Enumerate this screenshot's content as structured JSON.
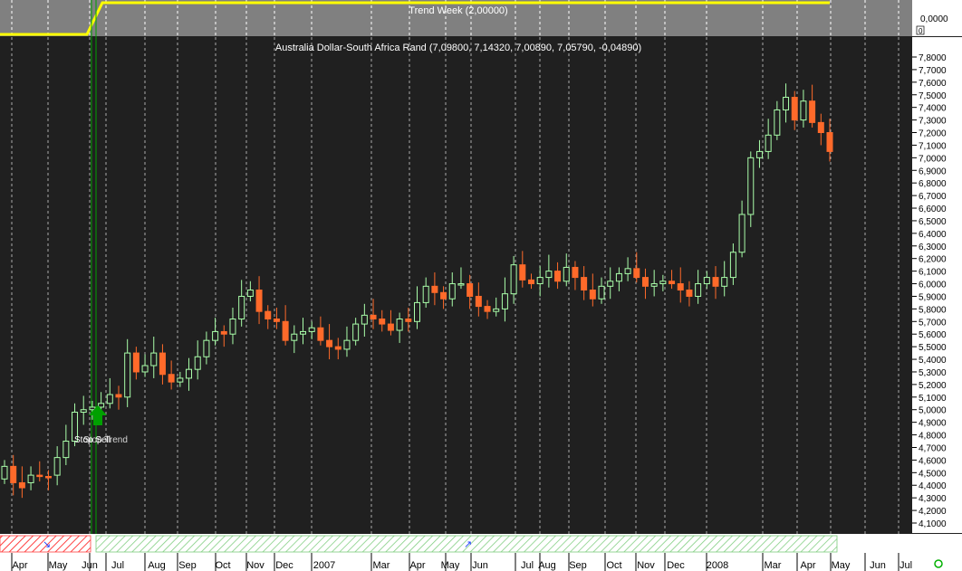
{
  "chart_data": {
    "type": "candlestick",
    "title": "Australia Dollar-South Africa Rand (7,09800, 7,14320, 7,00890, 7,05790, -0,04890)",
    "ylim": [
      4.0,
      7.9
    ],
    "y_ticks": [
      "7,8000",
      "7,7000",
      "7,6000",
      "7,5000",
      "7,4000",
      "7,3000",
      "7,2000",
      "7,1000",
      "7,0000",
      "6,9000",
      "6,8000",
      "6,7000",
      "6,6000",
      "6,5000",
      "6,4000",
      "6,3000",
      "6,2000",
      "6,1000",
      "6,0000",
      "5,9000",
      "5,8000",
      "5,7000",
      "5,6000",
      "5,5000",
      "5,4000",
      "5,3000",
      "5,2000",
      "5,1000",
      "5,0000",
      "4,9000",
      "4,8000",
      "4,7000",
      "4,6000",
      "4,5000",
      "4,4000",
      "4,3000",
      "4,2000",
      "4,1000"
    ],
    "x_ticks": [
      "Apr",
      "May",
      "Jun",
      "Jul",
      "Aug",
      "Sep",
      "Oct",
      "Nov",
      "Dec",
      "2007",
      "Mar",
      "Apr",
      "May",
      "Jun",
      "Jul",
      "Aug",
      "Sep",
      "Oct",
      "Nov",
      "Dec",
      "2008",
      "Mar",
      "Apr",
      "May",
      "Jun",
      "Jul"
    ],
    "closes": [
      4.55,
      4.42,
      4.38,
      4.48,
      4.47,
      4.46,
      4.62,
      4.75,
      4.98,
      5.0,
      5.02,
      5.05,
      5.12,
      5.1,
      5.45,
      5.3,
      5.35,
      5.45,
      5.28,
      5.22,
      5.25,
      5.32,
      5.42,
      5.55,
      5.62,
      5.6,
      5.72,
      5.9,
      5.95,
      5.78,
      5.72,
      5.7,
      5.55,
      5.6,
      5.62,
      5.65,
      5.55,
      5.5,
      5.48,
      5.55,
      5.68,
      5.75,
      5.72,
      5.68,
      5.63,
      5.72,
      5.7,
      5.85,
      5.98,
      5.93,
      5.88,
      6.0,
      6.0,
      5.9,
      5.82,
      5.78,
      5.8,
      5.92,
      6.15,
      6.03,
      6.0,
      6.05,
      6.1,
      6.02,
      6.13,
      6.05,
      5.95,
      5.88,
      5.98,
      6.02,
      6.08,
      6.12,
      6.05,
      5.98,
      6.0,
      6.02,
      6.0,
      5.95,
      5.9,
      6.0,
      6.05,
      5.98,
      6.05,
      6.25,
      6.55,
      7.0,
      7.05,
      7.18,
      7.38,
      7.48,
      7.3,
      7.45,
      7.28,
      7.2,
      7.05
    ],
    "opens": [
      4.45,
      4.55,
      4.42,
      4.42,
      4.48,
      4.47,
      4.48,
      4.62,
      4.75,
      4.98,
      5.0,
      5.02,
      5.05,
      5.12,
      5.1,
      5.45,
      5.3,
      5.35,
      5.45,
      5.28,
      5.22,
      5.25,
      5.32,
      5.42,
      5.55,
      5.62,
      5.6,
      5.72,
      5.9,
      5.95,
      5.78,
      5.72,
      5.7,
      5.55,
      5.6,
      5.62,
      5.65,
      5.55,
      5.5,
      5.48,
      5.55,
      5.68,
      5.75,
      5.72,
      5.68,
      5.63,
      5.72,
      5.7,
      5.85,
      5.98,
      5.93,
      5.88,
      6.0,
      6.0,
      5.9,
      5.82,
      5.78,
      5.8,
      5.92,
      6.15,
      6.03,
      6.0,
      6.05,
      6.1,
      6.02,
      6.13,
      6.05,
      5.95,
      5.88,
      5.98,
      6.02,
      6.08,
      6.12,
      6.05,
      5.98,
      6.0,
      6.02,
      6.0,
      5.95,
      5.9,
      6.0,
      6.05,
      5.98,
      6.05,
      6.25,
      6.55,
      7.0,
      7.05,
      7.18,
      7.38,
      7.48,
      7.3,
      7.45,
      7.28,
      7.2
    ]
  },
  "indicator": {
    "label": "Trend Week (2,00000)",
    "value_label": "0,0000",
    "small_label": "0"
  },
  "signal_labels": [
    "Stop Sell",
    "Stop Trend"
  ],
  "colors": {
    "up": "#aaffaa",
    "down": "#ff6a2a",
    "grid": "#aaaaaa",
    "trend_line": "#ffff00",
    "signal": "#00a000"
  }
}
